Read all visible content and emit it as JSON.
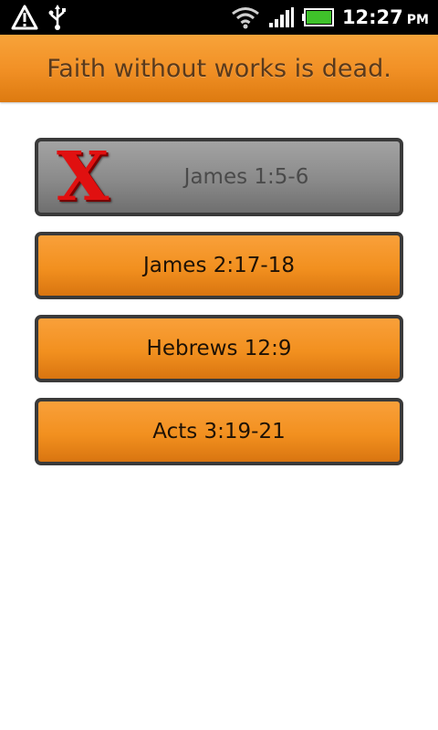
{
  "status_bar": {
    "time": "12:27",
    "ampm": "PM",
    "icons": [
      "warning-icon",
      "usb-icon",
      "wifi-icon",
      "signal-icon",
      "battery-icon"
    ]
  },
  "header": {
    "title": "Faith without works is dead."
  },
  "answers": [
    {
      "label": "James 1:5-6",
      "state": "wrong",
      "mark": "X"
    },
    {
      "label": "James 2:17-18",
      "state": "active"
    },
    {
      "label": "Hebrews 12:9",
      "state": "active"
    },
    {
      "label": "Acts 3:19-21",
      "state": "active"
    }
  ],
  "colors": {
    "accent": "#f29126",
    "wrong_mark": "#e01010",
    "disabled": "#8a8a8a",
    "border": "#3a3a3a"
  }
}
